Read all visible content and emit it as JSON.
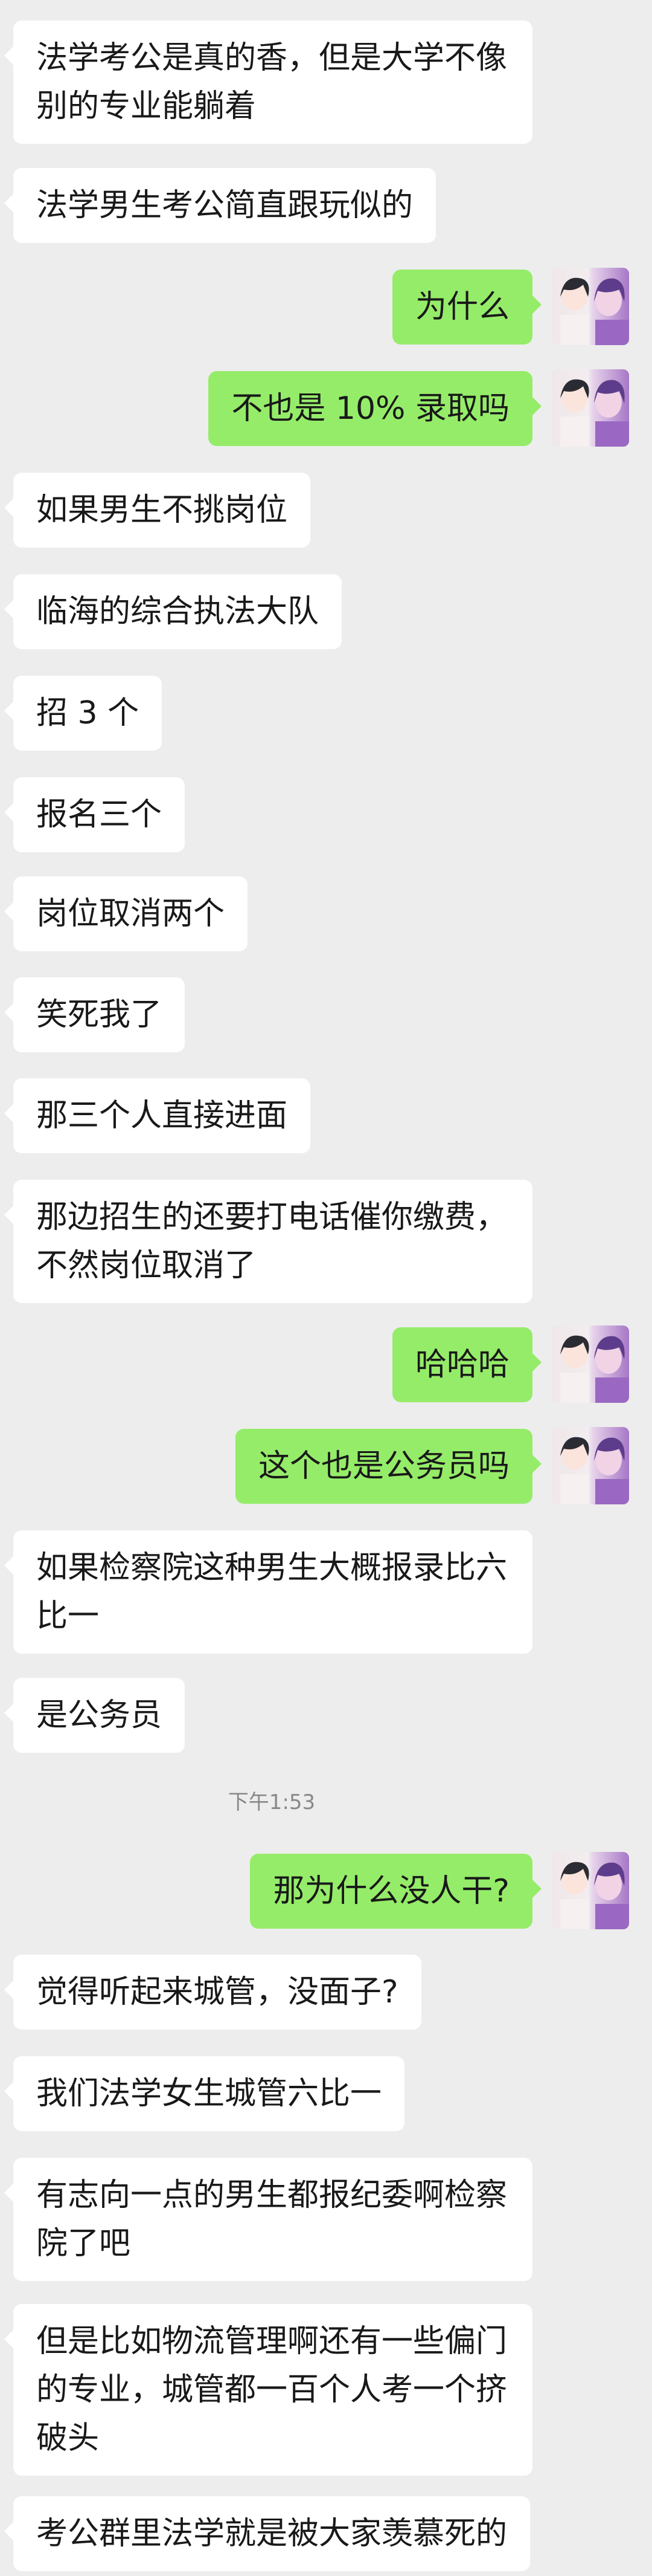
{
  "chat": {
    "messages": [
      {
        "side": "left",
        "text": "法学考公是真的香，但是大学不像别的专业能躺着"
      },
      {
        "side": "left",
        "text": "法学男生考公简直跟玩似的"
      },
      {
        "side": "right",
        "text": "为什么"
      },
      {
        "side": "right",
        "text": "不也是 10% 录取吗"
      },
      {
        "side": "left",
        "text": "如果男生不挑岗位"
      },
      {
        "side": "left",
        "text": "临海的综合执法大队"
      },
      {
        "side": "left",
        "text": "招 3 个"
      },
      {
        "side": "left",
        "text": "报名三个"
      },
      {
        "side": "left",
        "text": "岗位取消两个"
      },
      {
        "side": "left",
        "text": "笑死我了"
      },
      {
        "side": "left",
        "text": "那三个人直接进面"
      },
      {
        "side": "left",
        "text": "那边招生的还要打电话催你缴费，不然岗位取消了"
      },
      {
        "side": "right",
        "text": "哈哈哈"
      },
      {
        "side": "right",
        "text": "这个也是公务员吗"
      },
      {
        "side": "left",
        "text": "如果检察院这种男生大概报录比六比一"
      },
      {
        "side": "left",
        "text": "是公务员"
      },
      {
        "side": "right",
        "text": "那为什么没人干?"
      },
      {
        "side": "left",
        "text": "觉得听起来城管，没面子?"
      },
      {
        "side": "left",
        "text": "我们法学女生城管六比一"
      },
      {
        "side": "left",
        "text": "有志向一点的男生都报纪委啊检察院了吧"
      },
      {
        "side": "left",
        "text": "但是比如物流管理啊还有一些偏门的专业，城管都一百个人考一个挤破头"
      },
      {
        "side": "left",
        "text": "考公群里法学就是被大家羡慕死的"
      }
    ],
    "timestamp": "下午1:53"
  }
}
